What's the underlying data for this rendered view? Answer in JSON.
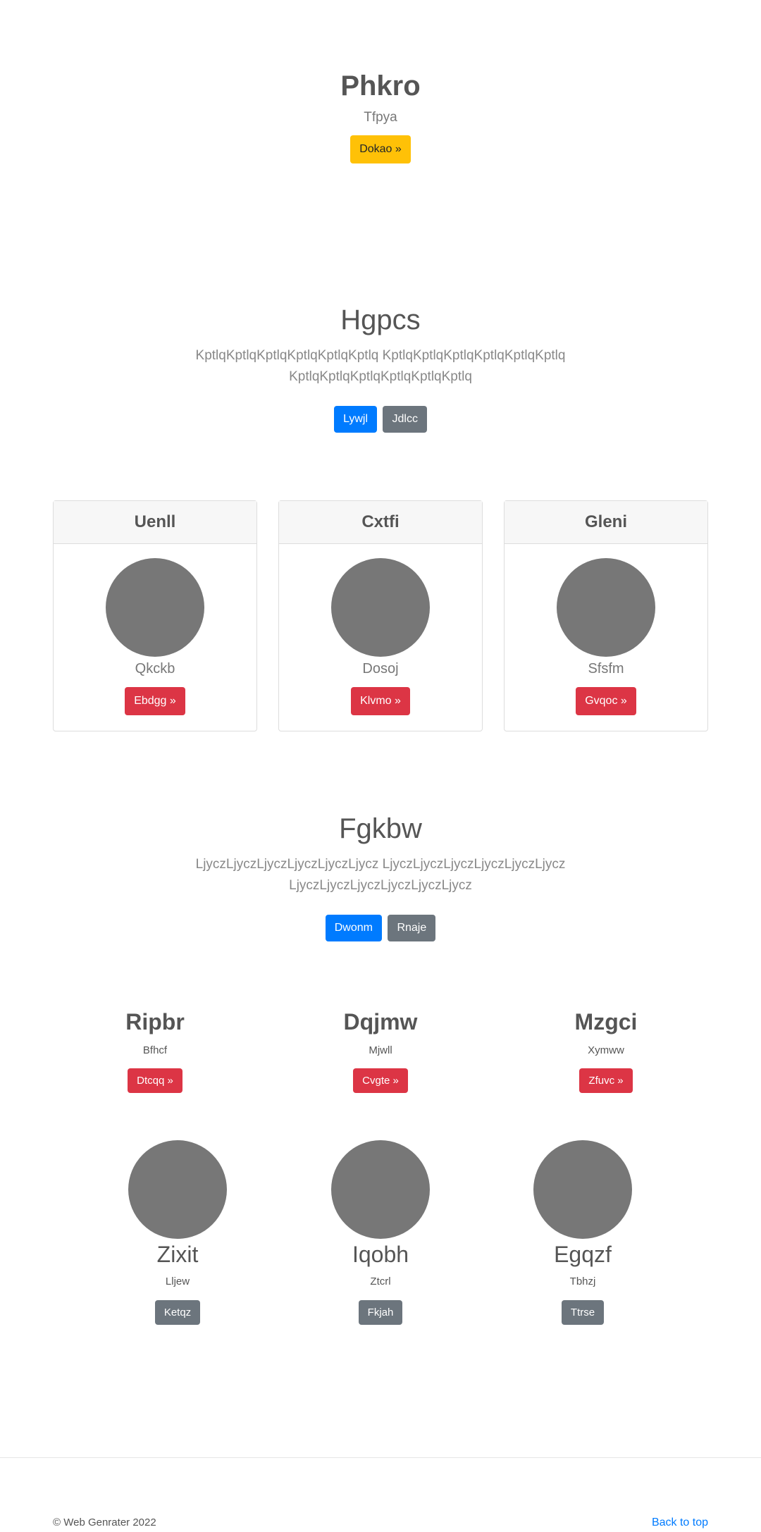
{
  "hero": {
    "title": "Phkro",
    "subtitle": "Tfpya",
    "button": "Dokao »"
  },
  "section1": {
    "title": "Hgpcs",
    "text": "KptlqKptlqKptlqKptlqKptlqKptlq KptlqKptlqKptlqKptlqKptlqKptlq KptlqKptlqKptlqKptlqKptlqKptlq",
    "primary": "Lywjl",
    "secondary": "Jdlcc"
  },
  "cards": [
    {
      "title": "Uenll",
      "caption": "Qkckb",
      "button": "Ebdgg »"
    },
    {
      "title": "Cxtfi",
      "caption": "Dosoj",
      "button": "Klvmo »"
    },
    {
      "title": "Gleni",
      "caption": "Sfsfm",
      "button": "Gvqoc »"
    }
  ],
  "section2": {
    "title": "Fgkbw",
    "text": "LjyczLjyczLjyczLjyczLjyczLjycz LjyczLjyczLjyczLjyczLjyczLjycz LjyczLjyczLjyczLjyczLjyczLjycz",
    "primary": "Dwonm",
    "secondary": "Rnaje"
  },
  "features": [
    {
      "title": "Ripbr",
      "text": "Bfhcf",
      "button": "Dtcqq »"
    },
    {
      "title": "Dqjmw",
      "text": "Mjwll",
      "button": "Cvgte »"
    },
    {
      "title": "Mzgci",
      "text": "Xymww",
      "button": "Zfuvc »"
    }
  ],
  "profiles": [
    {
      "name": "Zixit",
      "text": "Lljew",
      "button": "Ketqz"
    },
    {
      "name": "Iqobh",
      "text": "Ztcrl",
      "button": "Fkjah"
    },
    {
      "name": "Egqzf",
      "text": "Tbhzj",
      "button": "Ttrse"
    }
  ],
  "footer": {
    "copyright": "© Web Genrater 2022",
    "back_to_top": "Back to top"
  },
  "colors": {
    "warning": "#ffc107",
    "primary": "#007bff",
    "secondary": "#6c757d",
    "danger": "#dc3545",
    "placeholder": "#777777"
  }
}
